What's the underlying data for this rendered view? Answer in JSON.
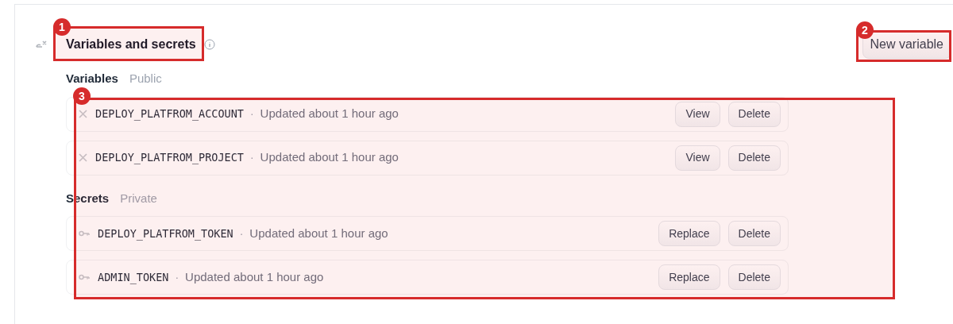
{
  "section": {
    "title": "Variables and secrets",
    "action": "New variable",
    "groups": [
      {
        "kind": "variable",
        "label": "Variables",
        "visibility": "Public",
        "items": [
          {
            "name": "DEPLOY_PLATFROM_ACCOUNT",
            "separator": "·",
            "updated": "Updated about 1 hour ago",
            "buttons": [
              "View",
              "Delete"
            ]
          },
          {
            "name": "DEPLOY_PLATFROM_PROJECT",
            "separator": "·",
            "updated": "Updated about 1 hour ago",
            "buttons": [
              "View",
              "Delete"
            ]
          }
        ]
      },
      {
        "kind": "secret",
        "label": "Secrets",
        "visibility": "Private",
        "items": [
          {
            "name": "DEPLOY_PLATFROM_TOKEN",
            "separator": "·",
            "updated": "Updated about 1 hour ago",
            "buttons": [
              "Replace",
              "Delete"
            ]
          },
          {
            "name": "ADMIN_TOKEN",
            "separator": "·",
            "updated": "Updated about 1 hour ago",
            "buttons": [
              "Replace",
              "Delete"
            ]
          }
        ]
      }
    ]
  },
  "annotations": [
    {
      "number": "1"
    },
    {
      "number": "2"
    },
    {
      "number": "3"
    }
  ]
}
